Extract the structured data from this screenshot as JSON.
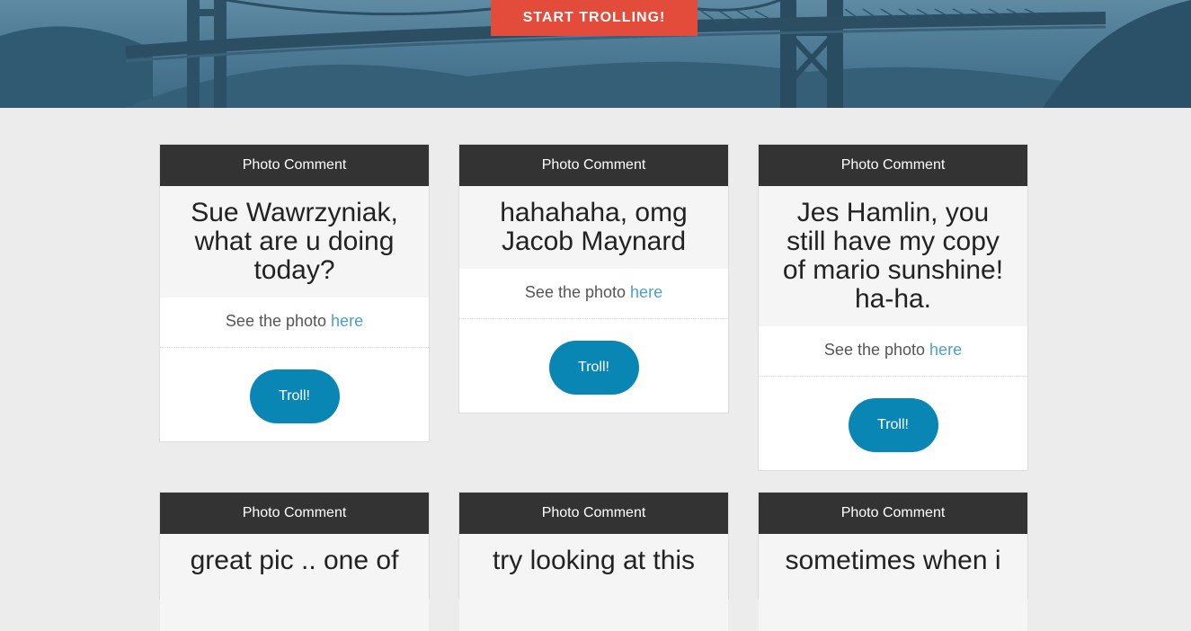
{
  "hero": {
    "cta_label": "START TROLLING!"
  },
  "cards": [
    {
      "header": "Photo Comment",
      "comment": "Sue Wawrzyniak, what are u doing today?",
      "link_prefix": "See the photo",
      "link_text": "here",
      "button_label": "Troll!"
    },
    {
      "header": "Photo Comment",
      "comment": "hahahaha, omg Jacob Maynard",
      "link_prefix": "See the photo",
      "link_text": "here",
      "button_label": "Troll!"
    },
    {
      "header": "Photo Comment",
      "comment": "Jes Hamlin, you still have my copy of mario sunshine! ha-ha.",
      "link_prefix": "See the photo",
      "link_text": "here",
      "button_label": "Troll!"
    },
    {
      "header": "Photo Comment",
      "comment": "great pic .. one of"
    },
    {
      "header": "Photo Comment",
      "comment": "try looking at this"
    },
    {
      "header": "Photo Comment",
      "comment": "sometimes when i"
    }
  ]
}
